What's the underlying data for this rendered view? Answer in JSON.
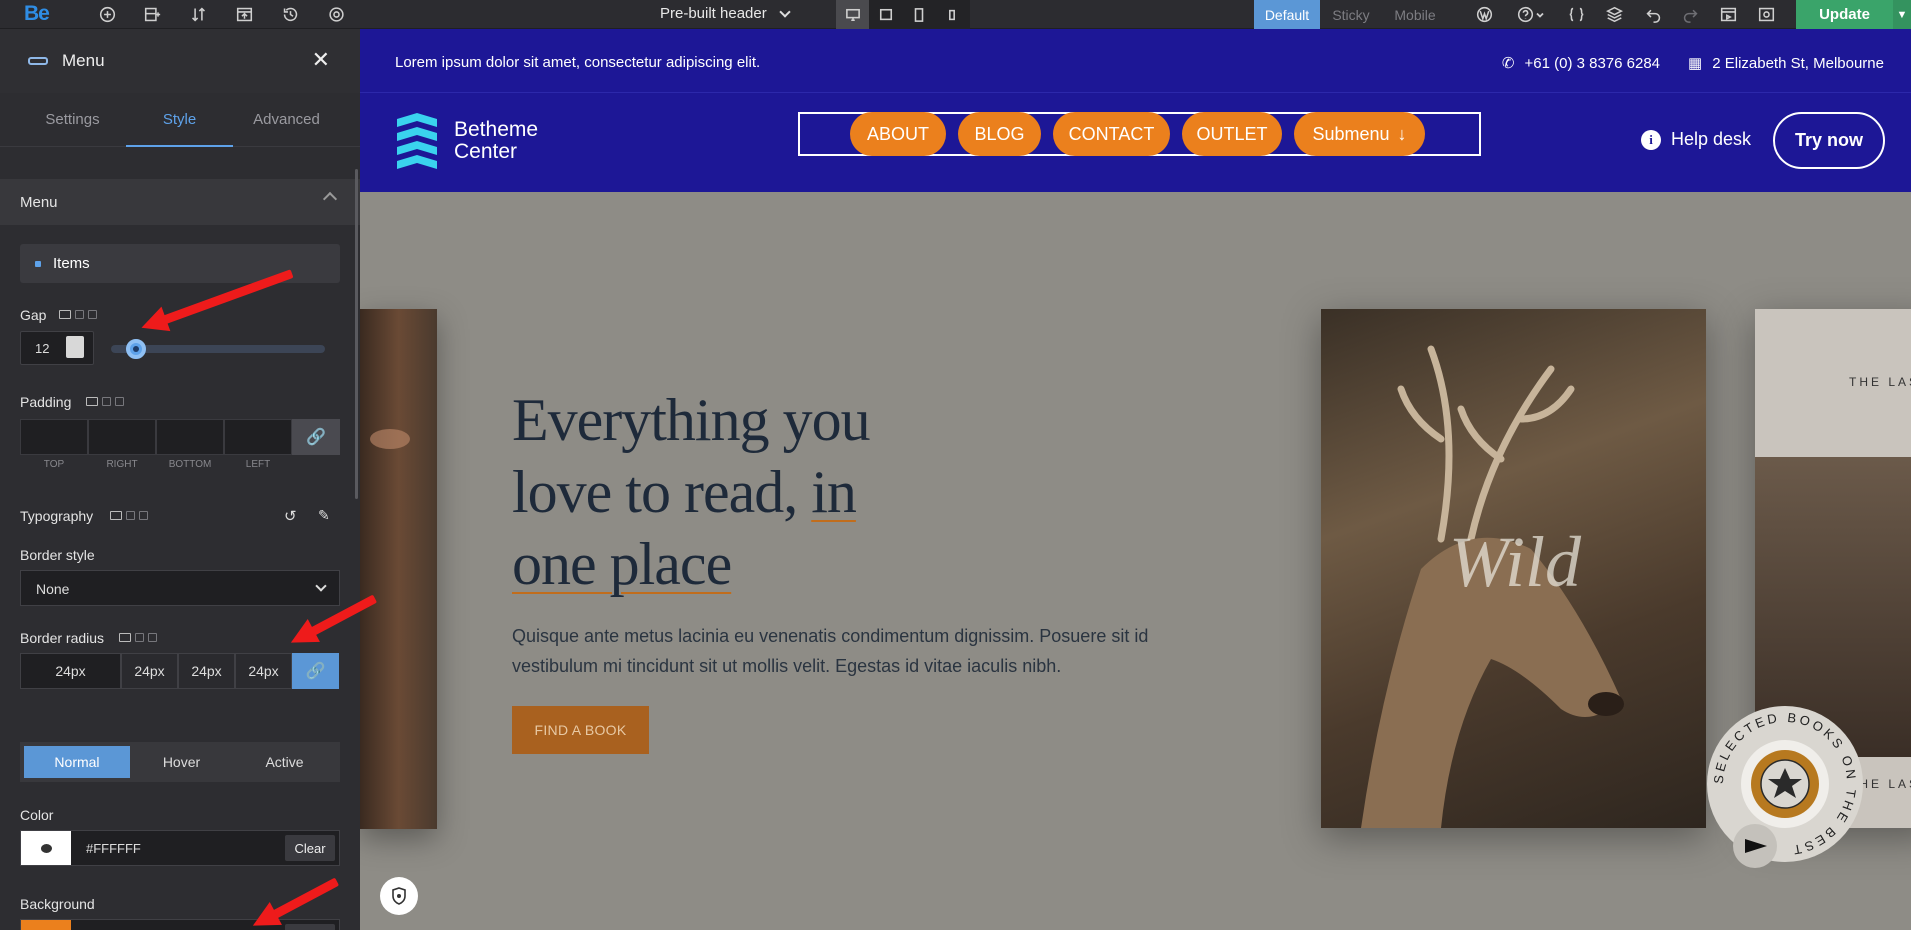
{
  "toolbar": {
    "logo": "Be",
    "header_selector": "Pre-built header",
    "views": [
      "Default",
      "Sticky",
      "Mobile"
    ],
    "update_label": "Update"
  },
  "sidebar": {
    "title": "Menu",
    "tabs": [
      "Settings",
      "Style",
      "Advanced"
    ],
    "section": "Menu",
    "items_label": "Items",
    "gap_label": "Gap",
    "gap_value": "12",
    "padding_label": "Padding",
    "padding_sides": [
      "TOP",
      "RIGHT",
      "BOTTOM",
      "LEFT"
    ],
    "typography_label": "Typography",
    "border_style_label": "Border style",
    "border_style_value": "None",
    "border_radius_label": "Border radius",
    "border_radius_values": [
      "24px",
      "24px",
      "24px",
      "24px"
    ],
    "states": [
      "Normal",
      "Hover",
      "Active"
    ],
    "color_label": "Color",
    "color_value": "#FFFFFF",
    "background_label": "Background",
    "background_value": "#EB801D",
    "clear_label": "Clear"
  },
  "preview": {
    "topbar_text": "Lorem ipsum dolor sit amet, consectetur adipiscing elit.",
    "phone": "+61 (0) 3 8376 6284",
    "address": "2 Elizabeth St, Melbourne",
    "brand_line1": "Betheme",
    "brand_line2": "Center",
    "nav": [
      "ABOUT",
      "BLOG",
      "CONTACT",
      "OUTLET",
      "Submenu"
    ],
    "help_desk": "Help desk",
    "try_now": "Try now",
    "hero_line1": "Everything you",
    "hero_line2a": "love to read,",
    "hero_line2b": "in",
    "hero_line3": "one place",
    "hero_text": "Quisque ante metus lacinia eu venenatis condimentum dignissim. Posuere sit id vestibulum mi tincidunt sit ut mollis velit. Egestas id vitae iaculis nibh.",
    "cta": "FIND A BOOK",
    "book_title": "Wild",
    "seal_text": "SELECTED BOOKS ON THE BEST",
    "book2_top": "THE LAS",
    "book2_bottom": "THE LAS"
  },
  "colors": {
    "accent": "#5B97D6",
    "brand_blue": "#1D1796",
    "orange": "#EB801D",
    "update_green": "#3AA46A"
  }
}
